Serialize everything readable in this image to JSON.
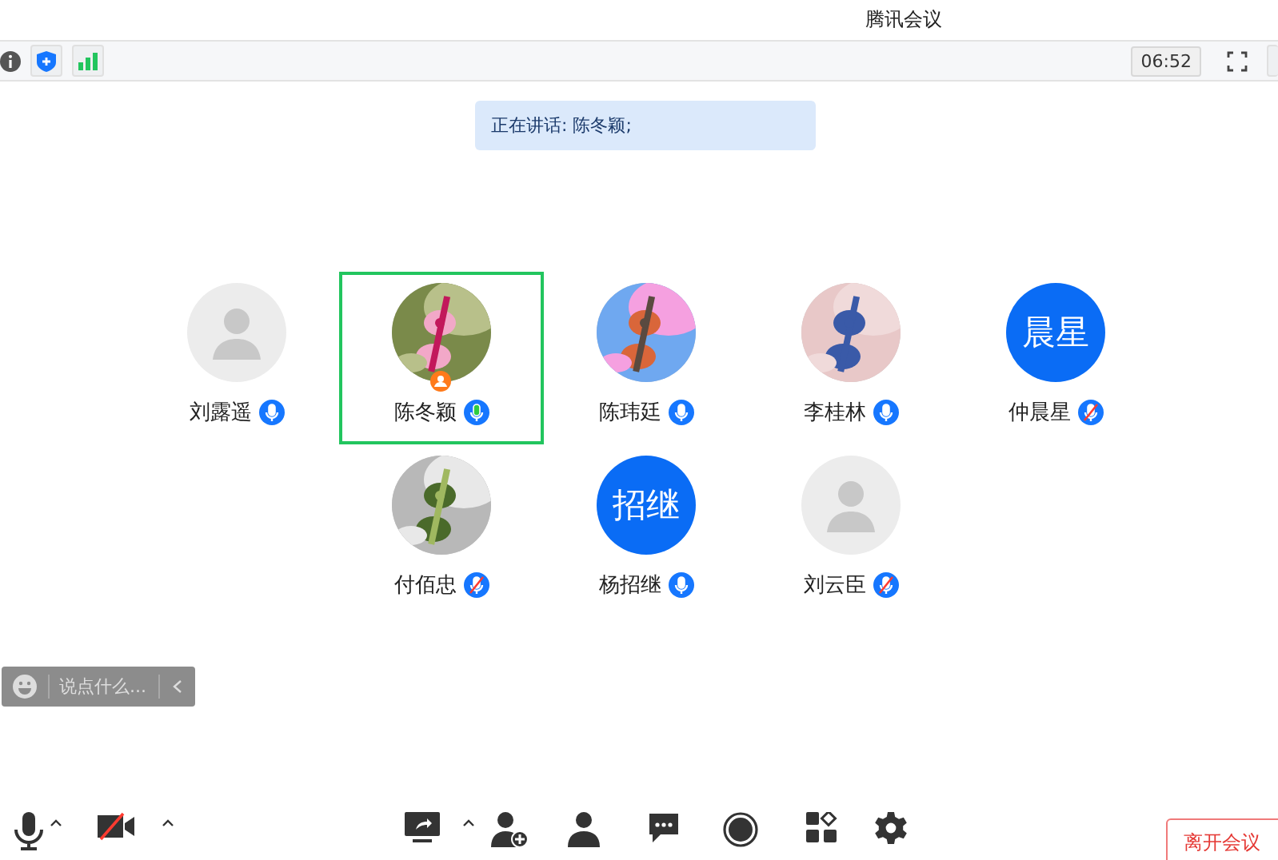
{
  "window": {
    "title": "腾讯会议"
  },
  "toolbar": {
    "timer": "06:52"
  },
  "speaker_banner": {
    "text": "正在讲话: 陈冬颖;"
  },
  "participants": [
    {
      "name": "刘露遥",
      "avatar": {
        "kind": "placeholder"
      },
      "muted": false,
      "speaking": false,
      "selected": false,
      "host": false
    },
    {
      "name": "陈冬颖",
      "muted": false,
      "speaking": true,
      "selected": true,
      "host": true
    },
    {
      "name": "陈玮廷",
      "muted": false,
      "speaking": false,
      "selected": false,
      "host": false
    },
    {
      "name": "李桂林",
      "muted": false,
      "speaking": false,
      "selected": false,
      "host": false
    },
    {
      "name": "仲晨星",
      "avatar": {
        "kind": "initials",
        "text": "晨星"
      },
      "muted": true,
      "speaking": false,
      "selected": false,
      "host": false
    },
    {
      "name": "付佰忠",
      "muted": true,
      "speaking": false,
      "selected": false,
      "host": false
    },
    {
      "name": "杨招继",
      "avatar": {
        "kind": "initials",
        "text": "招继"
      },
      "muted": false,
      "speaking": false,
      "selected": false,
      "host": false
    },
    {
      "name": "刘云臣",
      "avatar": {
        "kind": "placeholder"
      },
      "muted": true,
      "speaking": false,
      "selected": false,
      "host": false
    }
  ],
  "chat_input": {
    "placeholder": "说点什么..."
  },
  "bottom_bar": {
    "left": [
      {
        "caret": true
      },
      {
        "caret": true
      }
    ],
    "center": [
      {
        "caret": true
      },
      {
        "caret": false
      },
      {
        "caret": false
      },
      {
        "caret": false
      },
      {
        "caret": false
      },
      {
        "caret": false
      },
      {
        "caret": false
      }
    ],
    "leave_button": "离开会议"
  }
}
